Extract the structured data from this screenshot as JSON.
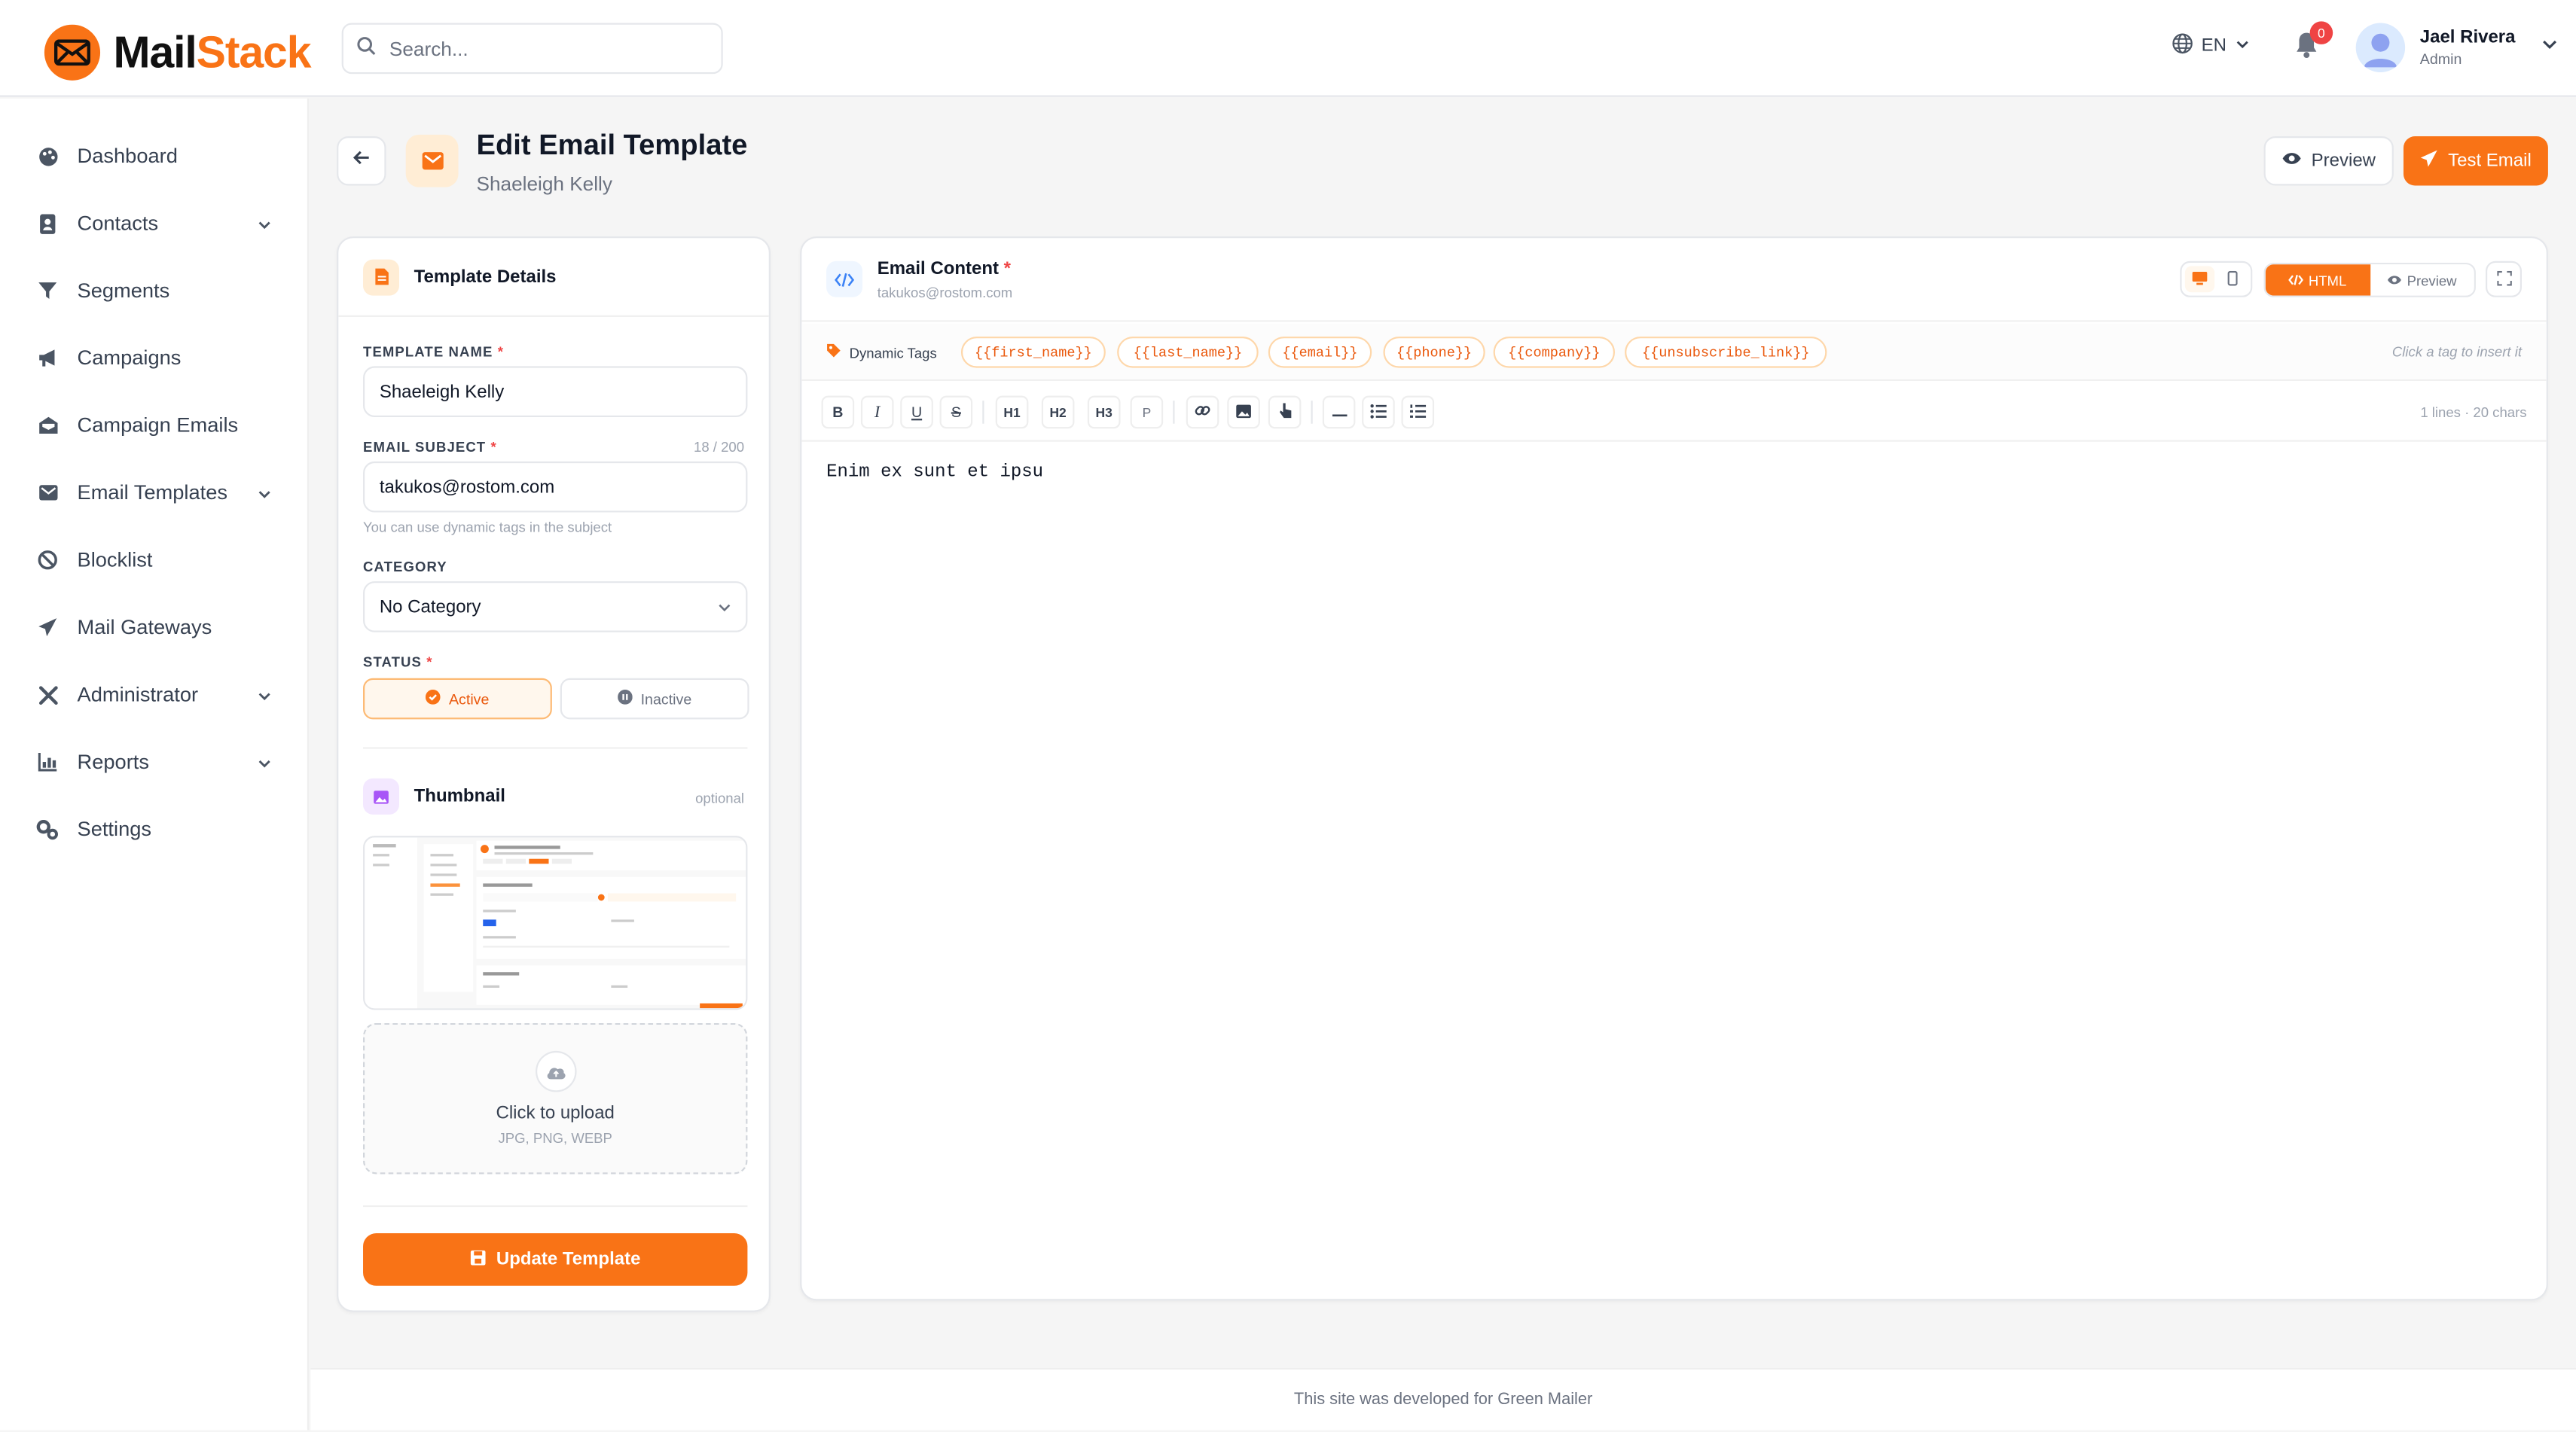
{
  "brand": {
    "name_part1": "Mail",
    "name_part2": "Stack",
    "accent": "#f97316"
  },
  "search": {
    "placeholder": "Search..."
  },
  "topbar": {
    "language": "EN",
    "notification_count": "0",
    "user_name": "Jael Rivera",
    "user_role": "Admin"
  },
  "sidebar": {
    "items": [
      {
        "label": "Dashboard",
        "icon": "palette-icon",
        "has_children": false
      },
      {
        "label": "Contacts",
        "icon": "address-book-icon",
        "has_children": true
      },
      {
        "label": "Segments",
        "icon": "filter-icon",
        "has_children": false
      },
      {
        "label": "Campaigns",
        "icon": "megaphone-icon",
        "has_children": false
      },
      {
        "label": "Campaign Emails",
        "icon": "envelope-open-icon",
        "has_children": false
      },
      {
        "label": "Email Templates",
        "icon": "mail-bulk-icon",
        "has_children": true
      },
      {
        "label": "Blocklist",
        "icon": "ban-icon",
        "has_children": false
      },
      {
        "label": "Mail Gateways",
        "icon": "paper-plane-icon",
        "has_children": false
      },
      {
        "label": "Administrator",
        "icon": "tools-icon",
        "has_children": true
      },
      {
        "label": "Reports",
        "icon": "chart-bar-icon",
        "has_children": true
      },
      {
        "label": "Settings",
        "icon": "cogs-icon",
        "has_children": false
      }
    ]
  },
  "header": {
    "title": "Edit Email Template",
    "subtitle": "Shaeleigh Kelly",
    "preview_label": "Preview",
    "test_email_label": "Test Email"
  },
  "details": {
    "title": "Template Details",
    "name_label": "TEMPLATE NAME",
    "name_value": "Shaeleigh Kelly",
    "subject_label": "EMAIL SUBJECT",
    "subject_counter": "18 / 200",
    "subject_value": "takukos@rostom.com",
    "subject_hint": "You can use dynamic tags in the subject",
    "category_label": "CATEGORY",
    "category_value": "No Category",
    "status_label": "STATUS",
    "status_active": "Active",
    "status_inactive": "Inactive",
    "thumbnail_title": "Thumbnail",
    "thumbnail_optional": "optional",
    "upload_title": "Click to upload",
    "upload_types": "JPG, PNG, WEBP",
    "update_label": "Update Template"
  },
  "content": {
    "title": "Email Content",
    "subtitle": "takukos@rostom.com",
    "mode_html": "HTML",
    "mode_preview": "Preview",
    "tags_label": "Dynamic Tags",
    "tags": [
      "{{first_name}}",
      "{{last_name}}",
      "{{email}}",
      "{{phone}}",
      "{{company}}",
      "{{unsubscribe_link}}"
    ],
    "tags_hint": "Click a tag to insert it",
    "toolbar": {
      "bold": "B",
      "italic": "I",
      "underline": "U",
      "strike": "S",
      "h1": "H1",
      "h2": "H2",
      "h3": "H3",
      "p": "P"
    },
    "stats": "1 lines · 20 chars",
    "body": "Enim ex sunt et ipsu"
  },
  "footer": {
    "text": "This site was developed for Green Mailer"
  }
}
